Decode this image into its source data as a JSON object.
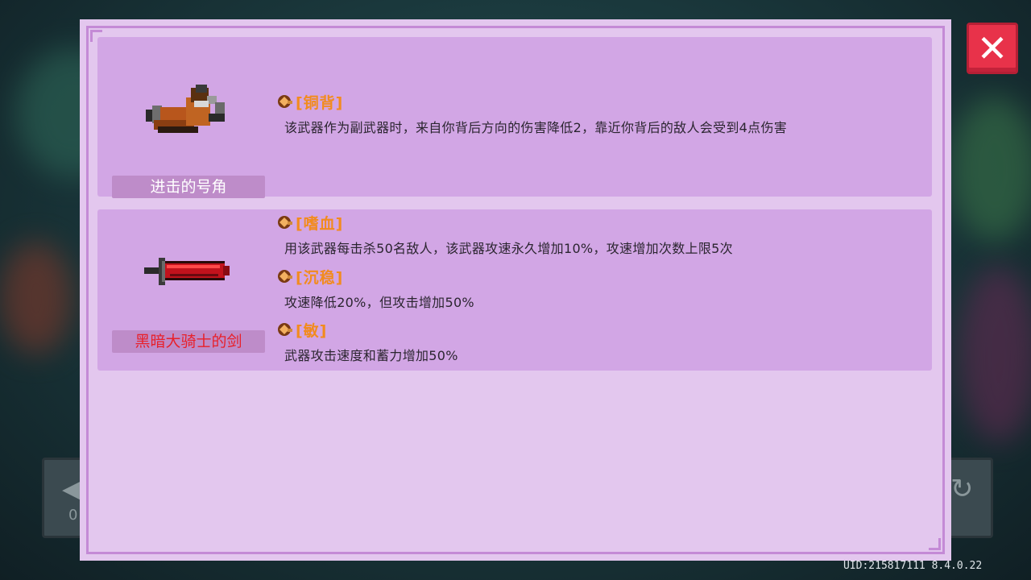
{
  "side_buttons": {
    "left": {
      "glyph": "◀",
      "label": "0"
    },
    "right": {
      "glyph": "↻"
    }
  },
  "cards": [
    {
      "weapon_name": "进击的号角",
      "weapon_name_color": "#ffffff",
      "weapon_icon": "horn-icon",
      "traits": [
        {
          "name": "[铜背]",
          "desc": "该武器作为副武器时，来自你背后方向的伤害降低2，靠近你背后的敌人会受到4点伤害"
        }
      ]
    },
    {
      "weapon_name": "黑暗大骑士的剑",
      "weapon_name_color": "#e8202a",
      "weapon_icon": "sword-icon",
      "traits": [
        {
          "name": "[嗜血]",
          "desc": "用该武器每击杀50名敌人，该武器攻速永久增加10%，攻速增加次数上限5次"
        },
        {
          "name": "[沉稳]",
          "desc": "攻速降低20%，但攻击增加50%"
        },
        {
          "name": "[敏]",
          "desc": "武器攻击速度和蓄力增加50%"
        }
      ]
    }
  ],
  "close_button": {
    "label": "✕"
  },
  "uid_text": "UID:215817111 8.4.0.22",
  "colors": {
    "panel_bg": "#e3c7ee",
    "card_bg": "#d2a6e5",
    "trait_title": "#f28b1e",
    "close_bg": "#e8324a"
  }
}
